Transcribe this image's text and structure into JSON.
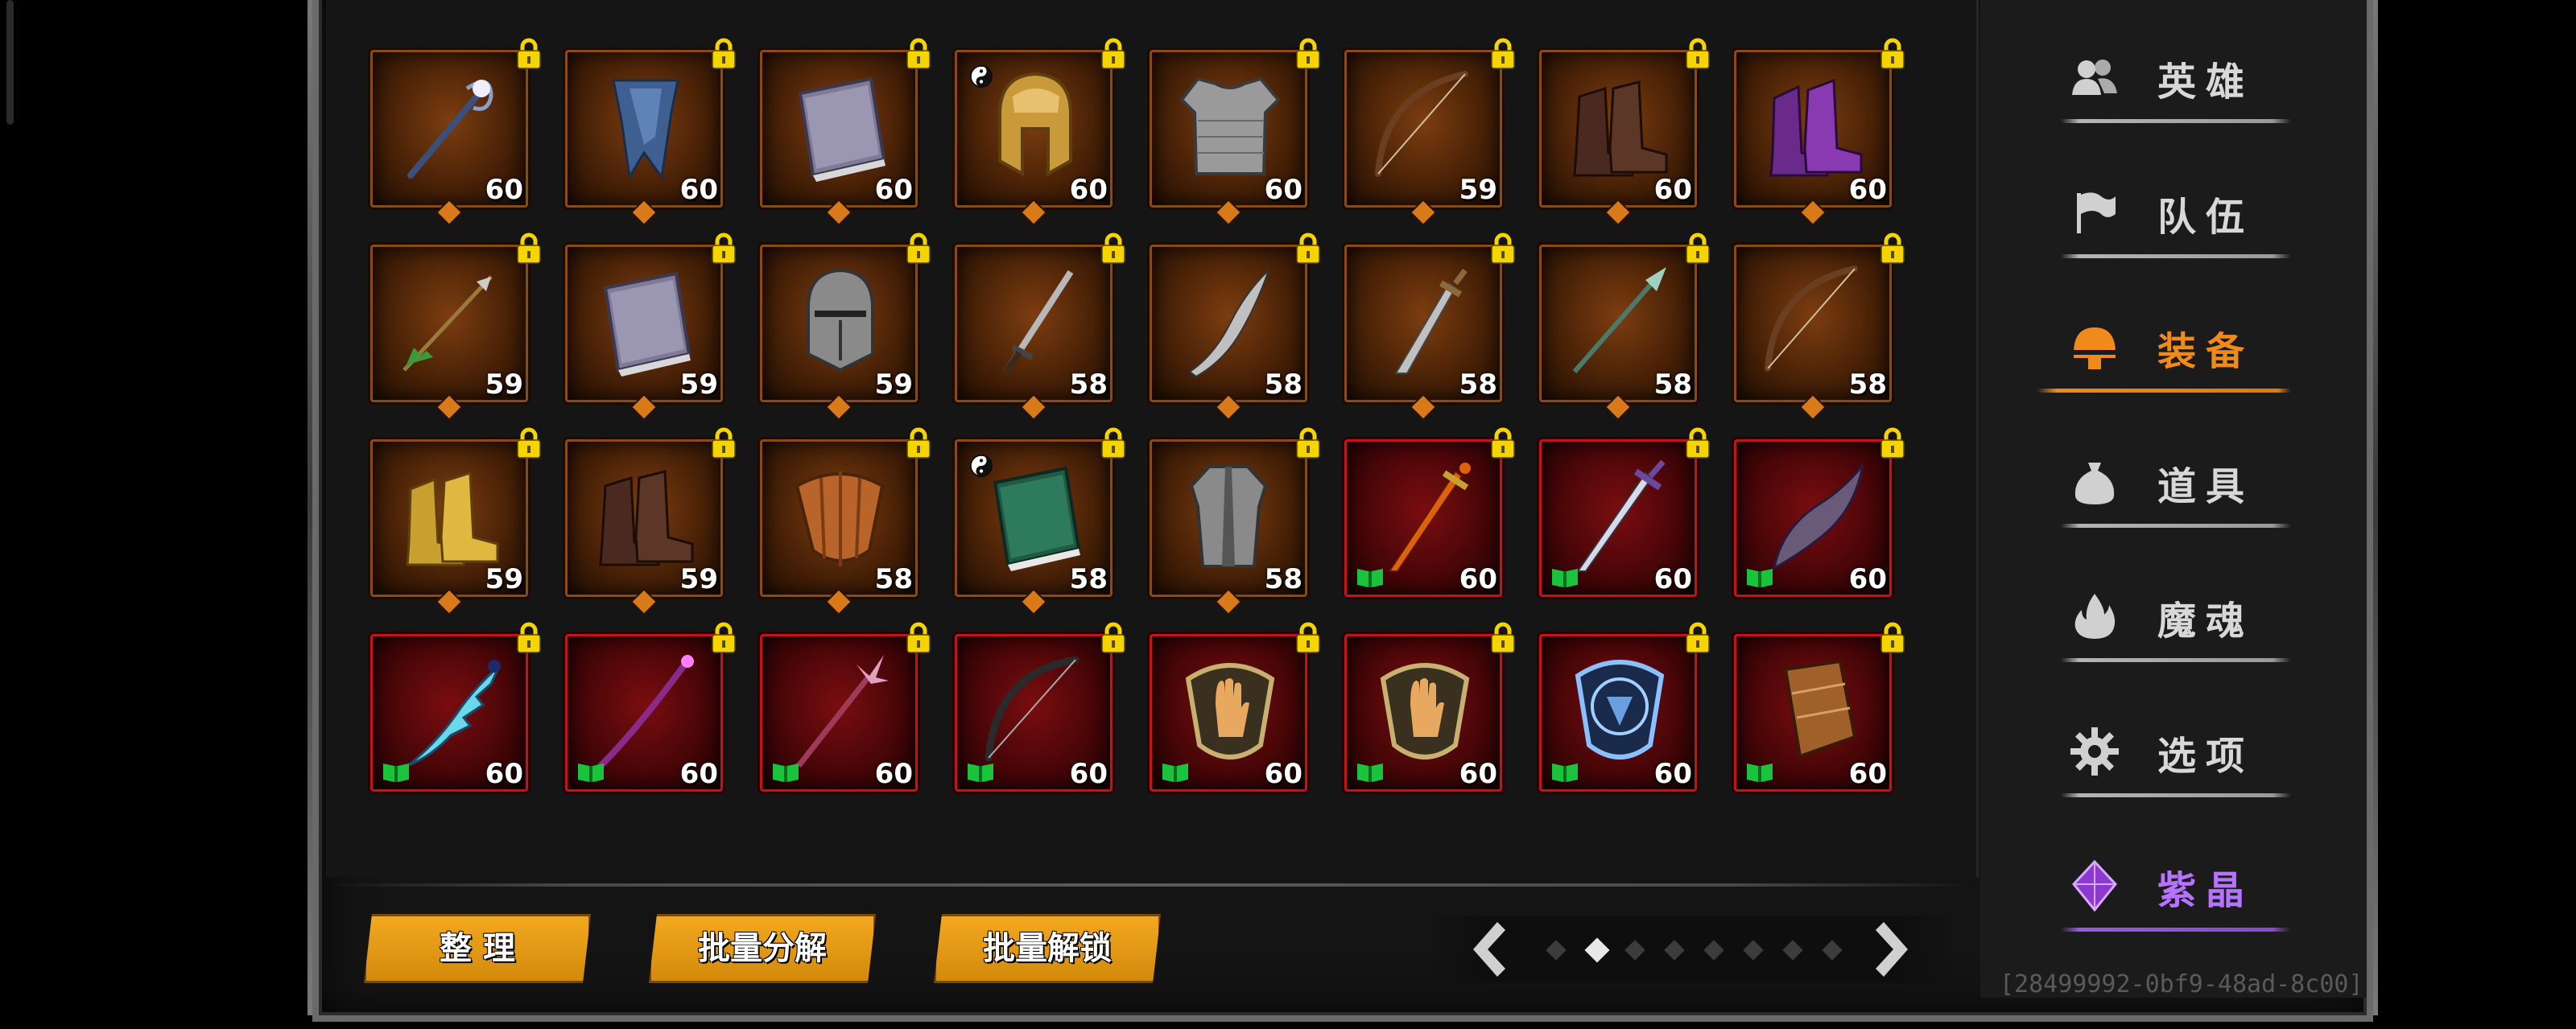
{
  "colors": {
    "orange_accent": "#f08a1a",
    "gold_button": "#e39a14",
    "red_frame": "#c1141a",
    "bronze_frame": "#8a4a14",
    "purple_accent": "#b673ff",
    "lock_yellow": "#f5d400",
    "book_green": "#19c43c"
  },
  "inventory": {
    "rows": [
      [
        {
          "icon": "staff-icon",
          "level": "60",
          "rarity": "epic",
          "locked": true,
          "badge": "diamond"
        },
        {
          "icon": "cape-icon",
          "level": "60",
          "rarity": "epic",
          "locked": true,
          "badge": "diamond"
        },
        {
          "icon": "tome-icon",
          "level": "60",
          "rarity": "epic",
          "locked": true,
          "badge": "diamond"
        },
        {
          "icon": "golden-helmet-icon",
          "level": "60",
          "rarity": "epic",
          "locked": true,
          "badge": "diamond",
          "yin_yang": true
        },
        {
          "icon": "chainmail-icon",
          "level": "60",
          "rarity": "epic",
          "locked": true,
          "badge": "diamond"
        },
        {
          "icon": "bow-icon",
          "level": "59",
          "rarity": "epic",
          "locked": true,
          "badge": "diamond"
        },
        {
          "icon": "leather-boots-icon",
          "level": "60",
          "rarity": "epic",
          "locked": true,
          "badge": "diamond"
        },
        {
          "icon": "purple-boots-icon",
          "level": "60",
          "rarity": "epic",
          "locked": true,
          "badge": "diamond"
        }
      ],
      [
        {
          "icon": "arrow-icon",
          "level": "59",
          "rarity": "epic",
          "locked": true,
          "badge": "diamond"
        },
        {
          "icon": "tome-icon",
          "level": "59",
          "rarity": "epic",
          "locked": true,
          "badge": "diamond"
        },
        {
          "icon": "knight-helmet-icon",
          "level": "59",
          "rarity": "epic",
          "locked": true,
          "badge": "diamond"
        },
        {
          "icon": "sword-icon",
          "level": "58",
          "rarity": "epic",
          "locked": true,
          "badge": "diamond"
        },
        {
          "icon": "scimitar-icon",
          "level": "58",
          "rarity": "epic",
          "locked": true,
          "badge": "diamond"
        },
        {
          "icon": "dagger-icon",
          "level": "58",
          "rarity": "epic",
          "locked": true,
          "badge": "diamond"
        },
        {
          "icon": "spear-icon",
          "level": "58",
          "rarity": "epic",
          "locked": true,
          "badge": "diamond"
        },
        {
          "icon": "bow-icon",
          "level": "58",
          "rarity": "epic",
          "locked": true,
          "badge": "diamond"
        }
      ],
      [
        {
          "icon": "golden-boots-icon",
          "level": "59",
          "rarity": "epic",
          "locked": true,
          "badge": "diamond"
        },
        {
          "icon": "leather-boots-icon",
          "level": "59",
          "rarity": "epic",
          "locked": true,
          "badge": "diamond"
        },
        {
          "icon": "wooden-shield-icon",
          "level": "58",
          "rarity": "epic",
          "locked": true,
          "badge": "diamond"
        },
        {
          "icon": "green-tome-icon",
          "level": "58",
          "rarity": "epic",
          "locked": true,
          "badge": "diamond",
          "yin_yang": true
        },
        {
          "icon": "robe-icon",
          "level": "58",
          "rarity": "epic",
          "locked": true,
          "badge": "diamond"
        },
        {
          "icon": "fire-sword-icon",
          "level": "60",
          "rarity": "legendary",
          "locked": true,
          "badge": "book"
        },
        {
          "icon": "longsword-icon",
          "level": "60",
          "rarity": "legendary",
          "locked": true,
          "badge": "book"
        },
        {
          "icon": "curved-blade-icon",
          "level": "60",
          "rarity": "legendary",
          "locked": true,
          "badge": "book"
        }
      ],
      [
        {
          "icon": "ice-blade-icon",
          "level": "60",
          "rarity": "legendary",
          "locked": true,
          "badge": "book"
        },
        {
          "icon": "magic-staff-icon",
          "level": "60",
          "rarity": "legendary",
          "locked": true,
          "badge": "book"
        },
        {
          "icon": "trident-staff-icon",
          "level": "60",
          "rarity": "legendary",
          "locked": true,
          "badge": "book"
        },
        {
          "icon": "dark-bow-icon",
          "level": "60",
          "rarity": "legendary",
          "locked": true,
          "badge": "book"
        },
        {
          "icon": "hand-shield-icon",
          "level": "60",
          "rarity": "legendary",
          "locked": true,
          "badge": "book"
        },
        {
          "icon": "hand-shield-icon",
          "level": "60",
          "rarity": "legendary",
          "locked": true,
          "badge": "book"
        },
        {
          "icon": "rune-shield-icon",
          "level": "60",
          "rarity": "legendary",
          "locked": true,
          "badge": "book"
        },
        {
          "icon": "bracer-icon",
          "level": "60",
          "rarity": "legendary",
          "locked": true,
          "badge": "book"
        }
      ]
    ]
  },
  "actions": {
    "sort_label": "整 理",
    "batch_dismantle_label": "批量分解",
    "batch_unlock_label": "批量解锁"
  },
  "pager": {
    "prev_icon": "chevron-left-icon",
    "next_icon": "chevron-right-icon",
    "page_count": 8,
    "current_page": 2
  },
  "sidebar": {
    "items": [
      {
        "key": "heroes",
        "label": "英雄",
        "icon": "heroes-icon",
        "state": "normal"
      },
      {
        "key": "team",
        "label": "队伍",
        "icon": "flag-icon",
        "state": "normal"
      },
      {
        "key": "equipment",
        "label": "装备",
        "icon": "helmet-icon",
        "state": "active"
      },
      {
        "key": "items",
        "label": "道具",
        "icon": "bag-icon",
        "state": "normal"
      },
      {
        "key": "souls",
        "label": "魔魂",
        "icon": "flame-icon",
        "state": "normal"
      },
      {
        "key": "options",
        "label": "选项",
        "icon": "gear-icon",
        "state": "normal"
      },
      {
        "key": "crystal",
        "label": "紫晶",
        "icon": "crystal-icon",
        "state": "purple"
      }
    ]
  },
  "build_id": "[28499992-0bf9-48ad-8c00]"
}
